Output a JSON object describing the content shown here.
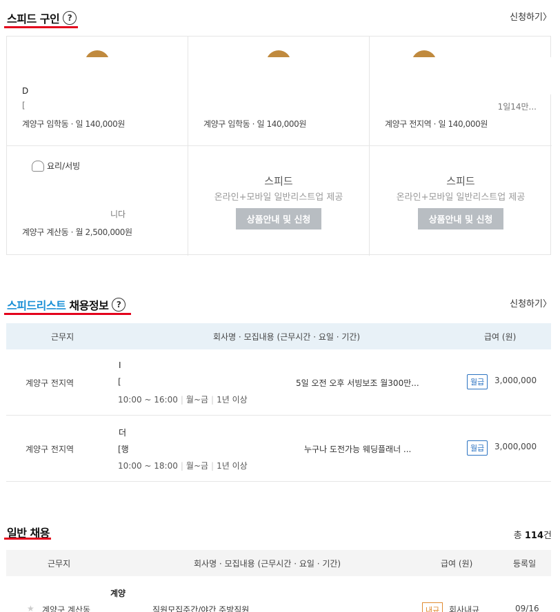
{
  "speed": {
    "title": "스피드 구인",
    "help": "?",
    "apply": "신청하기",
    "cards": [
      {
        "company": "D",
        "desc": "[",
        "location": "계양구 임학동 · 일 140,000원"
      },
      {
        "company": "",
        "desc": "",
        "location": "계양구 임학동 · 일 140,000원"
      },
      {
        "company": "",
        "desc": "1일14만...",
        "location": "계양구 전지역 · 일 140,000원"
      }
    ],
    "cook_card": {
      "category": "요리/서빙",
      "desc": "니다",
      "location": "계양구 계산동 · 월 2,500,000원"
    },
    "promo": {
      "title": "스피드",
      "sub": "온라인+모바일 일반리스트업 제공",
      "button": "상품안내 및 신청"
    }
  },
  "speedlist": {
    "title_blue": "스피드리스트",
    "title_rest": "채용정보",
    "help": "?",
    "apply": "신청하기",
    "headers": {
      "location": "근무지",
      "content": "회사명 · 모집내용 (근무시간 · 요일 · 기간)",
      "pay": "급여 (원)"
    },
    "rows": [
      {
        "location": "계양구 전지역",
        "company": "I",
        "title": "5일 오전 오후 서빙보조 월300만...",
        "time": "10:00 ~ 16:00",
        "days": "월~금",
        "period": "1년 이상",
        "pay_type": "월급",
        "pay": "3,000,000"
      },
      {
        "location": "계양구 전지역",
        "company": "더",
        "title": "누구나 도전가능 웨딩플래너 ...",
        "time": "10:00 ~ 18:00",
        "days": "월~금",
        "period": "1년 이상",
        "pay_type": "월급",
        "pay": "3,000,000"
      }
    ],
    "row2_prefix": "[행"
  },
  "general": {
    "title": "일반 채용",
    "total_label": "총",
    "total_count": "114",
    "total_unit": "건",
    "headers": {
      "location": "근무지",
      "content": "회사명 · 모집내용 (근무시간 · 요일 · 기간)",
      "pay": "급여 (원)",
      "date": "등록일"
    },
    "row": {
      "company": "계양",
      "location": "계양구 계산동",
      "title": "직원모집주간/야간 주방직원",
      "pay_type": "내규",
      "pay": "회사내규",
      "date": "09/16"
    }
  }
}
